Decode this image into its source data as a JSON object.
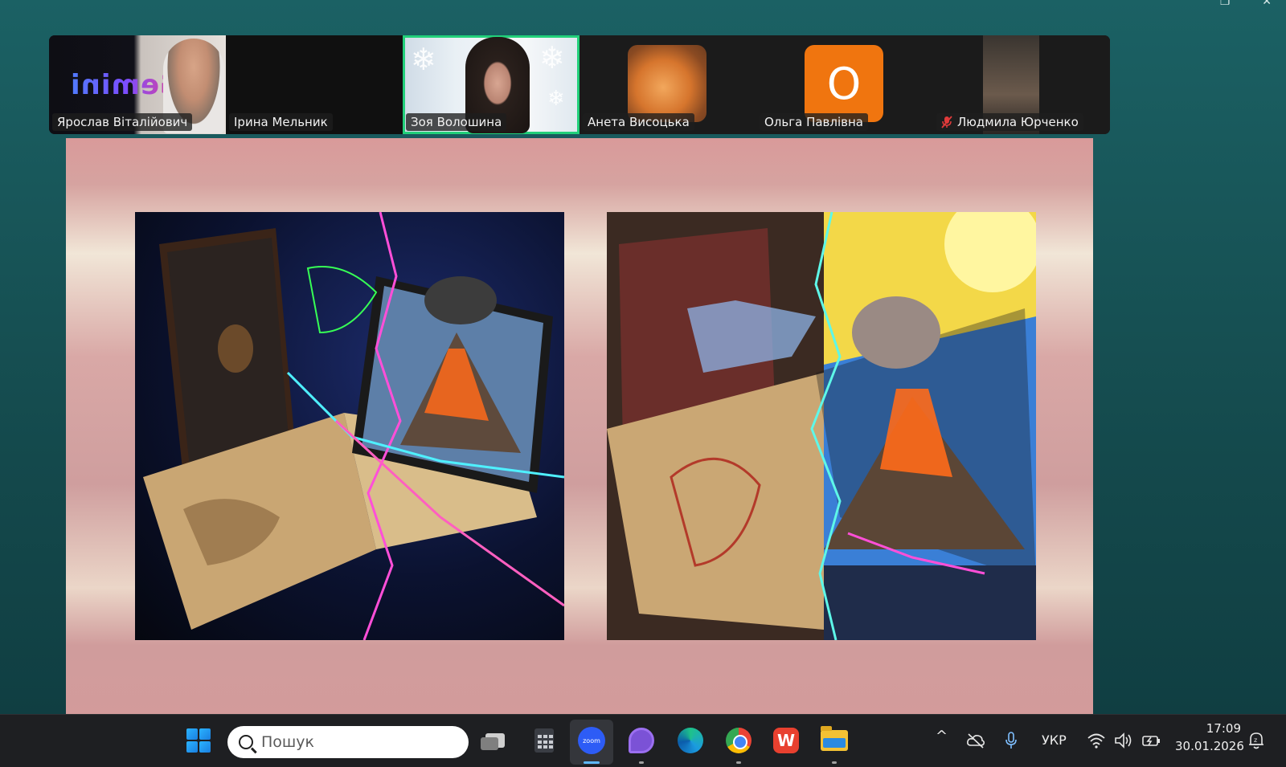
{
  "window": {
    "restore_glyph": "❐",
    "close_glyph": "✕"
  },
  "participants": [
    {
      "name": "Ярослав Віталійович",
      "overlay": "Gemini"
    },
    {
      "name": "Ірина Мельник"
    },
    {
      "name": "Зоя Волошина",
      "active_speaker": true
    },
    {
      "name": "Анета Висоцька"
    },
    {
      "name": "Ольга Павлівна",
      "initial": "О"
    },
    {
      "name": "Людмила Юрченко",
      "muted": true
    }
  ],
  "slide": {
    "left_image": "book-map-volcano-tablet-illustration",
    "right_image": "book-map-volcano-tablet-illustration"
  },
  "taskbar": {
    "search_placeholder": "Пошук",
    "apps": [
      "start-icon",
      "task-view-icon",
      "calculator-icon",
      "zoom-icon",
      "viber-icon",
      "edge-icon",
      "chrome-icon",
      "wps-icon",
      "file-explorer-icon"
    ],
    "zoom_label": "zoom",
    "wps_letter": "W",
    "tray": {
      "overflow_glyph": "^",
      "language": "УКР",
      "time": "17:09",
      "date": "30.01.2026"
    }
  },
  "colors": {
    "accent_speaker": "#22d07a",
    "zoom_blue": "#2d5cf6",
    "taskbar": "#1e1f22"
  }
}
